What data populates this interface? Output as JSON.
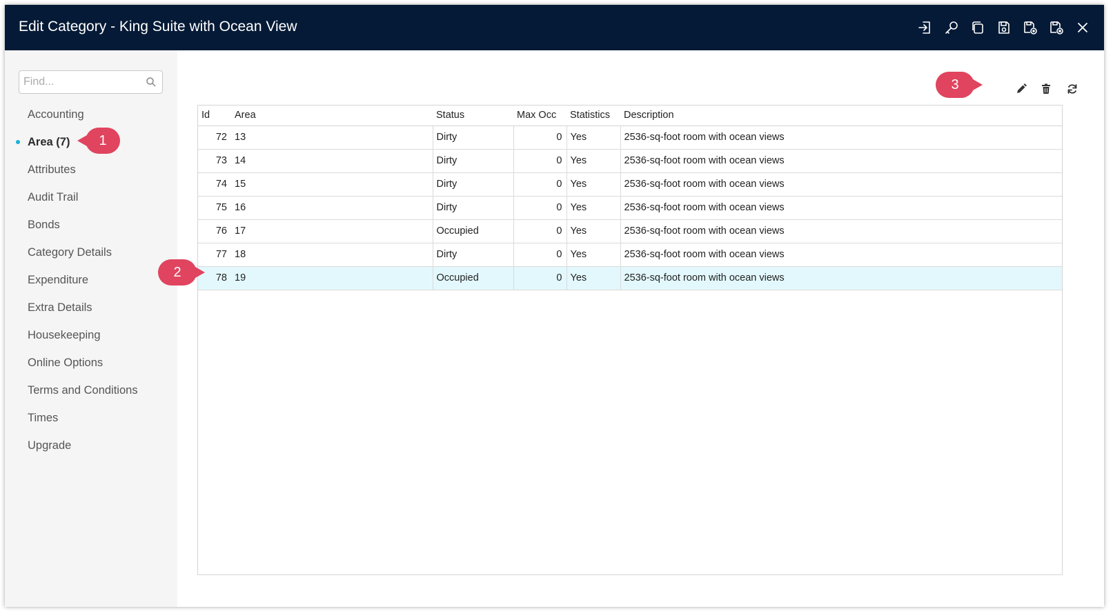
{
  "window": {
    "title": "Edit Category - King Suite with Ocean View"
  },
  "titlebar_icons": [
    {
      "name": "sign-in-icon"
    },
    {
      "name": "key-icon"
    },
    {
      "name": "copy-icon"
    },
    {
      "name": "save-icon"
    },
    {
      "name": "save-and-add-icon"
    },
    {
      "name": "save-and-close-icon"
    },
    {
      "name": "close-icon"
    }
  ],
  "sidebar": {
    "find_placeholder": "Find...",
    "items": [
      {
        "label": "Accounting"
      },
      {
        "label": "Area (7)",
        "active": true
      },
      {
        "label": "Attributes"
      },
      {
        "label": "Audit Trail"
      },
      {
        "label": "Bonds"
      },
      {
        "label": "Category Details"
      },
      {
        "label": "Expenditure"
      },
      {
        "label": "Extra Details"
      },
      {
        "label": "Housekeeping"
      },
      {
        "label": "Online Options"
      },
      {
        "label": "Terms and Conditions"
      },
      {
        "label": "Times"
      },
      {
        "label": "Upgrade"
      }
    ]
  },
  "toolbar": {
    "icons": [
      "grid-add-icon",
      "edit-icon",
      "delete-icon",
      "refresh-icon"
    ]
  },
  "table": {
    "columns": [
      "Id",
      "Area",
      "Status",
      "Max Occ",
      "Statistics",
      "Description"
    ],
    "rows": [
      {
        "id": "72",
        "area": "13",
        "status": "Dirty",
        "max_occ": "0",
        "statistics": "Yes",
        "description": "2536-sq-foot room with ocean views"
      },
      {
        "id": "73",
        "area": "14",
        "status": "Dirty",
        "max_occ": "0",
        "statistics": "Yes",
        "description": "2536-sq-foot room with ocean views"
      },
      {
        "id": "74",
        "area": "15",
        "status": "Dirty",
        "max_occ": "0",
        "statistics": "Yes",
        "description": "2536-sq-foot room with ocean views"
      },
      {
        "id": "75",
        "area": "16",
        "status": "Dirty",
        "max_occ": "0",
        "statistics": "Yes",
        "description": "2536-sq-foot room with ocean views"
      },
      {
        "id": "76",
        "area": "17",
        "status": "Occupied",
        "max_occ": "0",
        "statistics": "Yes",
        "description": "2536-sq-foot room with ocean views"
      },
      {
        "id": "77",
        "area": "18",
        "status": "Dirty",
        "max_occ": "0",
        "statistics": "Yes",
        "description": "2536-sq-foot room with ocean views"
      },
      {
        "id": "78",
        "area": "19",
        "status": "Occupied",
        "max_occ": "0",
        "statistics": "Yes",
        "description": "2536-sq-foot room with ocean views",
        "selected": true
      }
    ]
  },
  "callouts": [
    "1",
    "2",
    "3"
  ],
  "colors": {
    "titlebar": "#051a36",
    "active_dot": "#1bb0d9",
    "selected_row": "#e3f8fc",
    "callout": "#e0445e"
  }
}
